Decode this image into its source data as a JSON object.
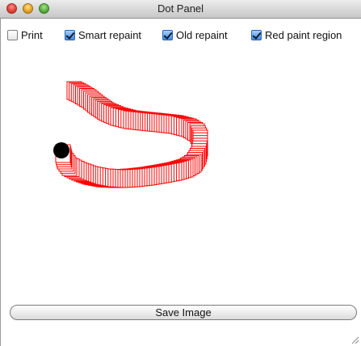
{
  "window": {
    "title": "Dot Panel"
  },
  "options": [
    {
      "label": "Print",
      "checked": false
    },
    {
      "label": "Smart repaint",
      "checked": true
    },
    {
      "label": "Old repaint",
      "checked": true
    },
    {
      "label": "Red paint region",
      "checked": true
    }
  ],
  "drawing": {
    "trail_color": "#ff0000",
    "dot_color": "#000000"
  },
  "actions": {
    "save_label": "Save Image"
  }
}
